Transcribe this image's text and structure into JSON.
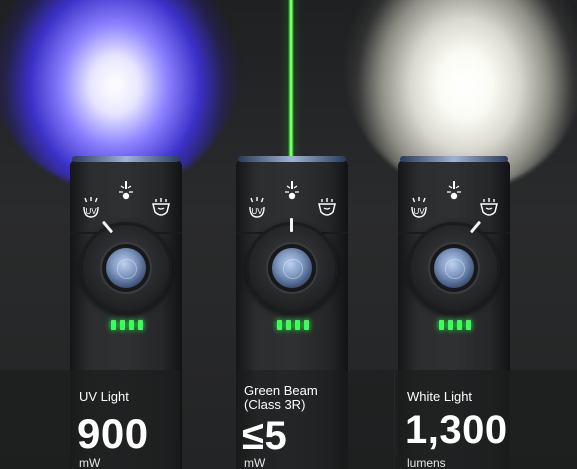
{
  "products": [
    {
      "label": "UV Light",
      "value": "900",
      "unit": "mW",
      "icons": {
        "left": "uv-icon",
        "mid": "laser-icon",
        "right": "floodlight-icon"
      },
      "indicator_leds": 4
    },
    {
      "label": "Green Beam\n(Class 3R)",
      "value": "≤5",
      "unit": "mW",
      "icons": {
        "left": "uv-icon",
        "mid": "laser-icon",
        "right": "floodlight-icon"
      },
      "indicator_leds": 4
    },
    {
      "label": "White Light",
      "value": "1,300",
      "unit": "lumens",
      "icons": {
        "left": "uv-icon",
        "mid": "laser-icon",
        "right": "floodlight-icon"
      },
      "indicator_leds": 4
    }
  ],
  "colors": {
    "uv_beam": "#3b30c8",
    "laser_beam": "#46ff3a",
    "white_beam": "#fbfbf5",
    "indicator_led": "#3cff5a",
    "caption_text": "#ffffff"
  }
}
